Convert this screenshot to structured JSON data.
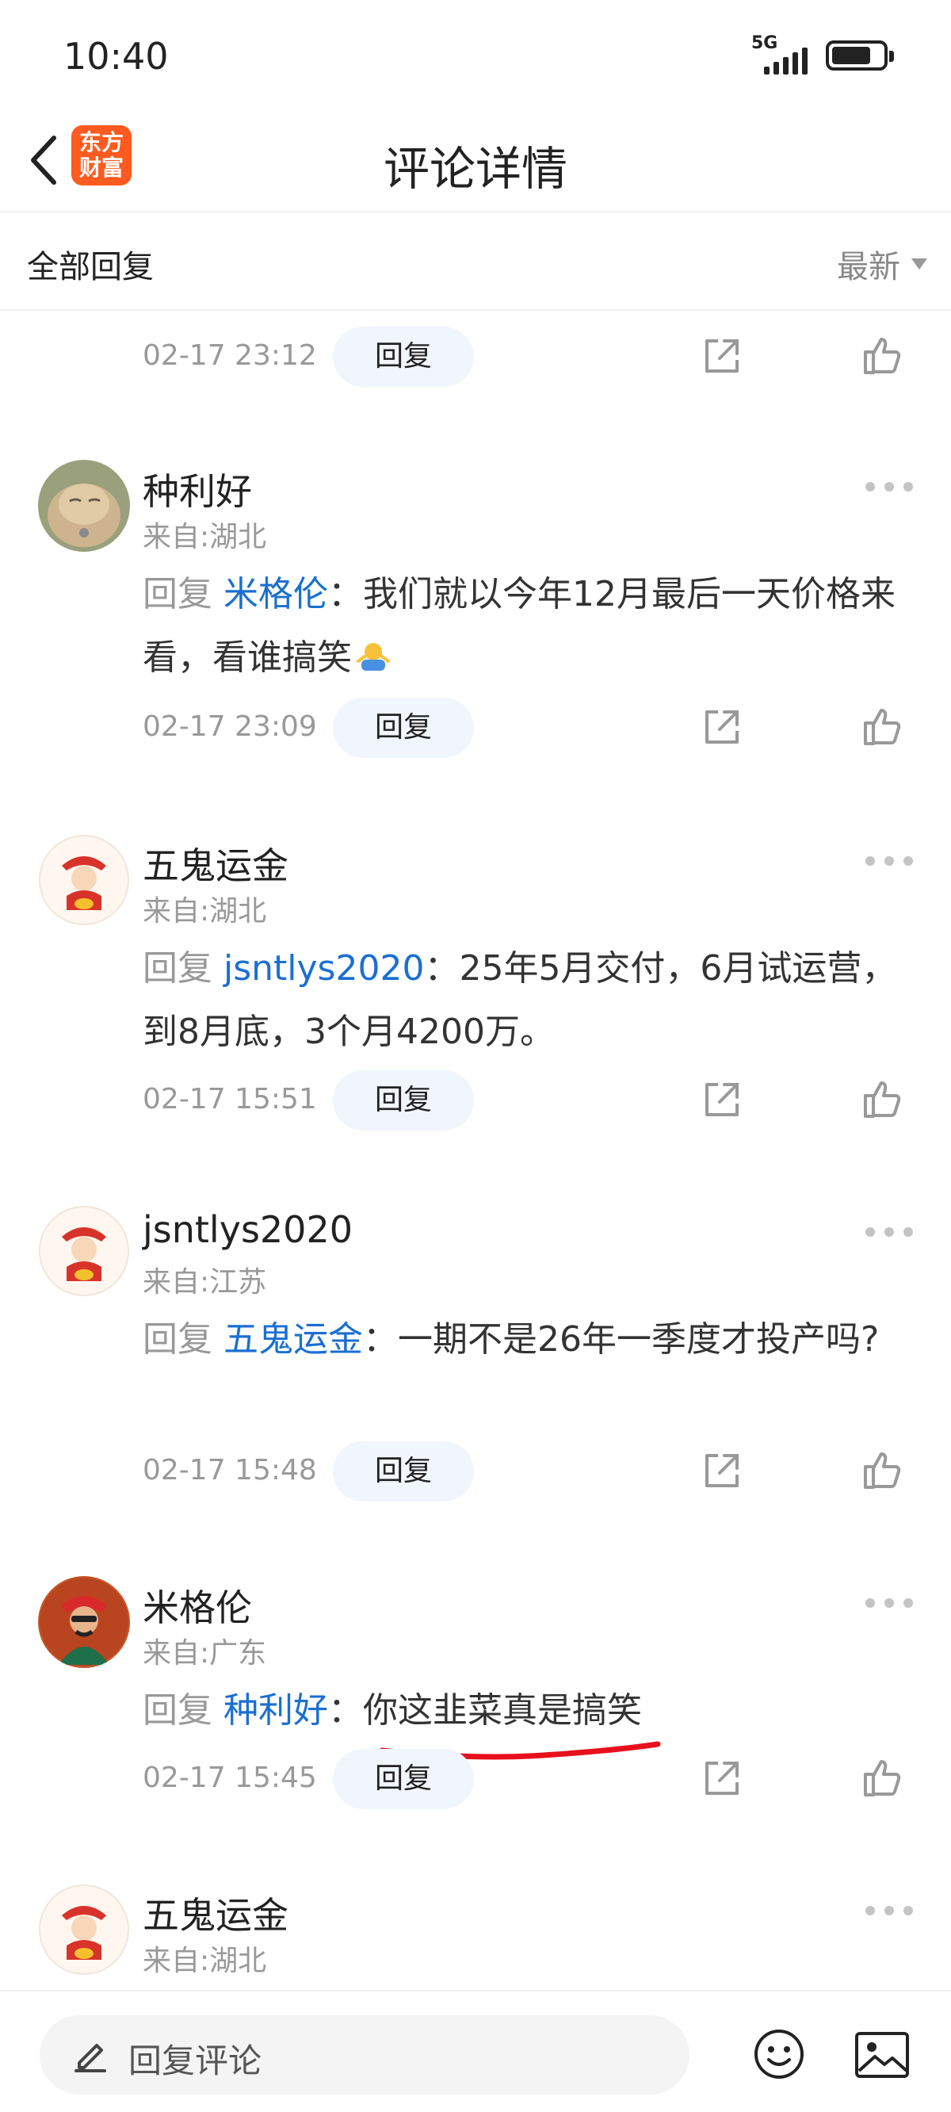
{
  "status_bar": {
    "time": "10:40",
    "network": "5G",
    "signal_bars": 5,
    "battery_level": 0.7
  },
  "header": {
    "title": "评论详情",
    "logo_line1": "东方",
    "logo_line2": "财富"
  },
  "filter": {
    "left_label": "全部回复",
    "sort_label": "最新"
  },
  "top_meta": {
    "date": "02-17 23:12",
    "reply_label": "回复"
  },
  "comments": [
    {
      "name": "种利好",
      "location": "来自:湖北",
      "reply_prefix": "回复 ",
      "reply_to": "米格伦",
      "separator": "：",
      "text": "我们就以今年12月最后一天价格来看，看谁搞笑",
      "emoji": "shrug-emoji",
      "date": "02-17 23:09",
      "reply_label": "回复"
    },
    {
      "name": "五鬼运金",
      "location": "来自:湖北",
      "reply_prefix": "回复 ",
      "reply_to": "jsntlys2020",
      "separator": "：",
      "text": "25年5月交付，6月试运营，到8月底，3个月4200万。",
      "date": "02-17 15:51",
      "reply_label": "回复"
    },
    {
      "name": "jsntlys2020",
      "location": "来自:江苏",
      "reply_prefix": "回复 ",
      "reply_to": "五鬼运金",
      "separator": "：",
      "text": "一期不是26年一季度才投产吗?",
      "date": "02-17 15:48",
      "reply_label": "回复"
    },
    {
      "name": "米格伦",
      "location": "来自:广东",
      "reply_prefix": "回复 ",
      "reply_to": "种利好",
      "separator": "：",
      "text": "你这韭菜真是搞笑",
      "date": "02-17 15:45",
      "reply_label": "回复"
    },
    {
      "name": "五鬼运金",
      "location": "来自:湖北"
    }
  ],
  "bottom_bar": {
    "placeholder": "回复评论",
    "icons": [
      "pen-icon",
      "emoji-icon",
      "image-icon"
    ]
  },
  "colors": {
    "link": "#1a6fd1",
    "muted": "#999999",
    "annotation": "#e8101c",
    "brand": "#ff5a1f"
  }
}
